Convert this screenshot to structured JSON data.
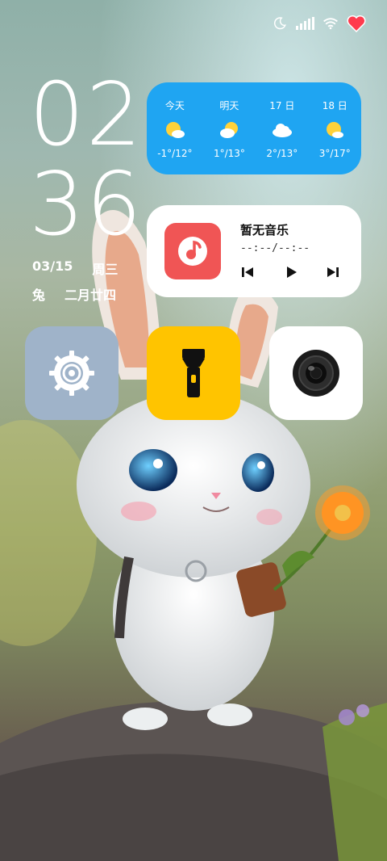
{
  "status_bar": {
    "icons": [
      "moon-icon",
      "signal-icon",
      "wifi-icon",
      "heart-icon"
    ]
  },
  "clock": {
    "hours": "02",
    "minutes": "36"
  },
  "date": {
    "date": "03/15",
    "weekday": "周三",
    "zodiac": "兔",
    "lunar": "二月廿四"
  },
  "weather": {
    "days": [
      {
        "label": "今天",
        "icon": "partly-sunny-icon",
        "temp": "-1°/12°"
      },
      {
        "label": "明天",
        "icon": "partly-sunny-icon",
        "temp": "1°/13°"
      },
      {
        "label": "17 日",
        "icon": "cloud-icon",
        "temp": "2°/13°"
      },
      {
        "label": "18 日",
        "icon": "partly-sunny-icon",
        "temp": "3°/17°"
      }
    ],
    "color": "#1fa5f2"
  },
  "music": {
    "title": "暂无音乐",
    "time": "--:--/--:--",
    "controls": [
      "previous-icon",
      "play-icon",
      "next-icon"
    ],
    "icon_color": "#f05555"
  },
  "shortcuts": [
    {
      "name": "settings",
      "icon": "gear-icon",
      "color": "#9fb3c9"
    },
    {
      "name": "flashlight",
      "icon": "flashlight-icon",
      "color": "#ffc400"
    },
    {
      "name": "camera",
      "icon": "camera-lens-icon",
      "color": "#ffffff"
    }
  ]
}
